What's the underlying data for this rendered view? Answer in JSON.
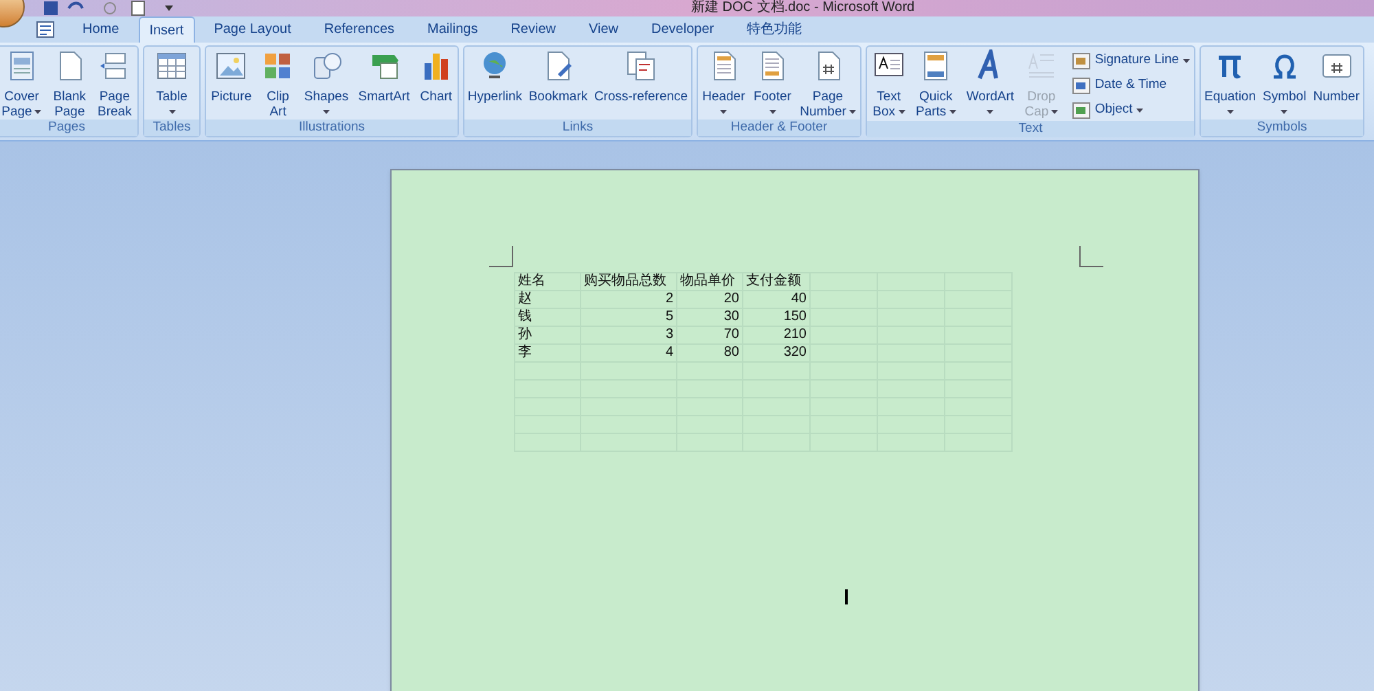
{
  "window": {
    "title": "新建 DOC 文档.doc - Microsoft Word"
  },
  "tabs": [
    {
      "label": "Home",
      "selected": false
    },
    {
      "label": "Insert",
      "selected": true
    },
    {
      "label": "Page Layout",
      "selected": false
    },
    {
      "label": "References",
      "selected": false
    },
    {
      "label": "Mailings",
      "selected": false
    },
    {
      "label": "Review",
      "selected": false
    },
    {
      "label": "View",
      "selected": false
    },
    {
      "label": "Developer",
      "selected": false
    },
    {
      "label": "特色功能",
      "selected": false
    }
  ],
  "ribbon": {
    "groups": [
      {
        "label": "Pages",
        "buttons": [
          {
            "kind": "large",
            "lines": [
              "Cover",
              "Page"
            ],
            "menu": true,
            "disabled": false
          },
          {
            "kind": "large",
            "lines": [
              "Blank",
              "Page"
            ],
            "menu": false,
            "disabled": false
          },
          {
            "kind": "large",
            "lines": [
              "Page",
              "Break"
            ],
            "menu": false,
            "disabled": false
          }
        ]
      },
      {
        "label": "Tables",
        "buttons": [
          {
            "kind": "large",
            "lines": [
              "Table"
            ],
            "menu": true,
            "disabled": false
          }
        ]
      },
      {
        "label": "Illustrations",
        "buttons": [
          {
            "kind": "large",
            "lines": [
              "Picture"
            ],
            "menu": false,
            "disabled": false
          },
          {
            "kind": "large",
            "lines": [
              "Clip",
              "Art"
            ],
            "menu": false,
            "disabled": false
          },
          {
            "kind": "large",
            "lines": [
              "Shapes"
            ],
            "menu": true,
            "disabled": false
          },
          {
            "kind": "large",
            "lines": [
              "SmartArt"
            ],
            "menu": false,
            "disabled": false
          },
          {
            "kind": "large",
            "lines": [
              "Chart"
            ],
            "menu": false,
            "disabled": false
          }
        ]
      },
      {
        "label": "Links",
        "buttons": [
          {
            "kind": "large",
            "lines": [
              "Hyperlink"
            ],
            "menu": false,
            "disabled": false
          },
          {
            "kind": "large",
            "lines": [
              "Bookmark"
            ],
            "menu": false,
            "disabled": false
          },
          {
            "kind": "large",
            "lines": [
              "Cross-reference"
            ],
            "menu": false,
            "disabled": false
          }
        ]
      },
      {
        "label": "Header & Footer",
        "buttons": [
          {
            "kind": "large",
            "lines": [
              "Header"
            ],
            "menu": true,
            "disabled": false
          },
          {
            "kind": "large",
            "lines": [
              "Footer"
            ],
            "menu": true,
            "disabled": false
          },
          {
            "kind": "large",
            "lines": [
              "Page",
              "Number"
            ],
            "menu": true,
            "disabled": false
          }
        ]
      },
      {
        "label": "Text",
        "buttons": [
          {
            "kind": "large",
            "lines": [
              "Text",
              "Box"
            ],
            "menu": true,
            "disabled": false
          },
          {
            "kind": "large",
            "lines": [
              "Quick",
              "Parts"
            ],
            "menu": true,
            "disabled": false
          },
          {
            "kind": "large",
            "lines": [
              "WordArt"
            ],
            "menu": true,
            "disabled": false
          },
          {
            "kind": "large",
            "lines": [
              "Drop",
              "Cap"
            ],
            "menu": true,
            "disabled": true
          },
          {
            "kind": "small",
            "lines": [
              "Signature Line"
            ],
            "menu": true,
            "disabled": false
          },
          {
            "kind": "small",
            "lines": [
              "Date & Time"
            ],
            "menu": false,
            "disabled": false
          },
          {
            "kind": "small",
            "lines": [
              "Object"
            ],
            "menu": true,
            "disabled": false
          }
        ]
      },
      {
        "label": "Symbols",
        "buttons": [
          {
            "kind": "large",
            "lines": [
              "Equation"
            ],
            "menu": true,
            "disabled": false
          },
          {
            "kind": "large",
            "lines": [
              "Symbol"
            ],
            "menu": true,
            "disabled": false
          },
          {
            "kind": "large",
            "lines": [
              "Number"
            ],
            "menu": false,
            "disabled": false
          }
        ]
      }
    ]
  },
  "document": {
    "table": {
      "columns": [
        "姓名",
        "购买物品总数",
        "物品单价",
        "支付金额"
      ],
      "rows": [
        [
          "赵",
          "2",
          "20",
          "40"
        ],
        [
          "钱",
          "5",
          "30",
          "150"
        ],
        [
          "孙",
          "3",
          "70",
          "210"
        ],
        [
          "李",
          "4",
          "80",
          "320"
        ]
      ]
    }
  }
}
